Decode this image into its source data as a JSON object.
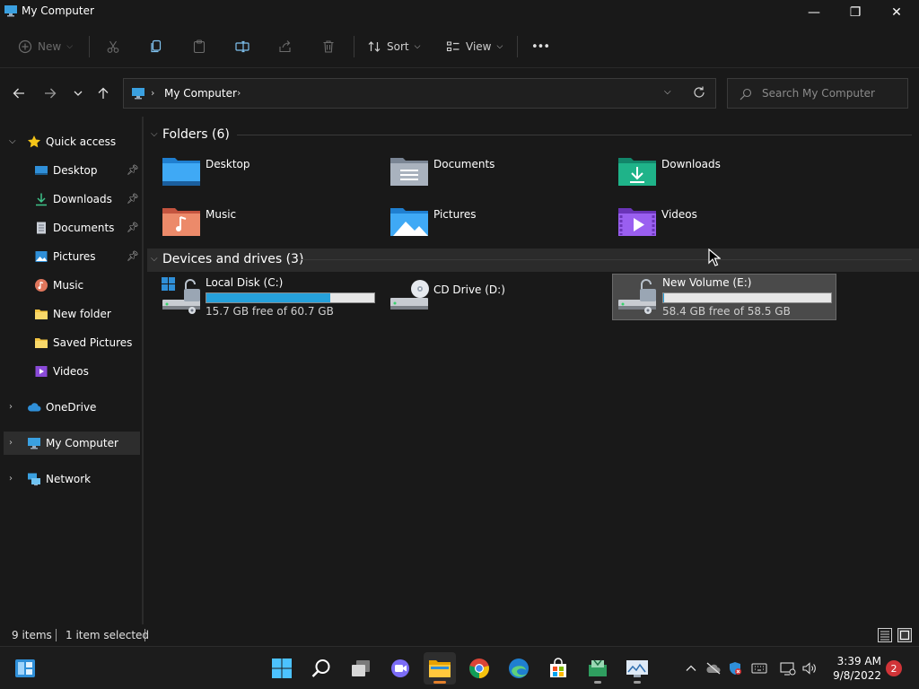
{
  "window": {
    "title": "My Computer",
    "minimize": "—",
    "maximize": "❐",
    "close": "✕"
  },
  "toolbar": {
    "new_label": "New",
    "sort_label": "Sort",
    "view_label": "View",
    "more_label": "•••"
  },
  "address": {
    "crumb": "My Computer"
  },
  "search": {
    "placeholder": "Search My Computer"
  },
  "sidebar": {
    "items": [
      {
        "label": "Quick access"
      },
      {
        "label": "Desktop"
      },
      {
        "label": "Downloads"
      },
      {
        "label": "Documents"
      },
      {
        "label": "Pictures"
      },
      {
        "label": "Music"
      },
      {
        "label": "New folder"
      },
      {
        "label": "Saved Pictures"
      },
      {
        "label": "Videos"
      },
      {
        "label": "OneDrive"
      },
      {
        "label": "My Computer"
      },
      {
        "label": "Network"
      }
    ]
  },
  "folders_group": {
    "title": "Folders (6)",
    "items": [
      {
        "name": "Desktop"
      },
      {
        "name": "Documents"
      },
      {
        "name": "Downloads"
      },
      {
        "name": "Music"
      },
      {
        "name": "Pictures"
      },
      {
        "name": "Videos"
      }
    ]
  },
  "drives_group": {
    "title": "Devices and drives (3)",
    "items": [
      {
        "name": "Local Disk (C:)",
        "free": "15.7 GB free of 60.7 GB",
        "used_fraction": 0.74
      },
      {
        "name": "CD Drive (D:)"
      },
      {
        "name": "New Volume (E:)",
        "free": "58.4 GB free of 58.5 GB",
        "used_fraction": 0.002
      }
    ]
  },
  "status": {
    "count": "9 items",
    "selection": "1 item selected"
  },
  "taskbar": {
    "time": "3:39 AM",
    "date": "9/8/2022",
    "notifications": "2"
  },
  "colors": {
    "accent": "#26a0da",
    "background": "#191919"
  }
}
